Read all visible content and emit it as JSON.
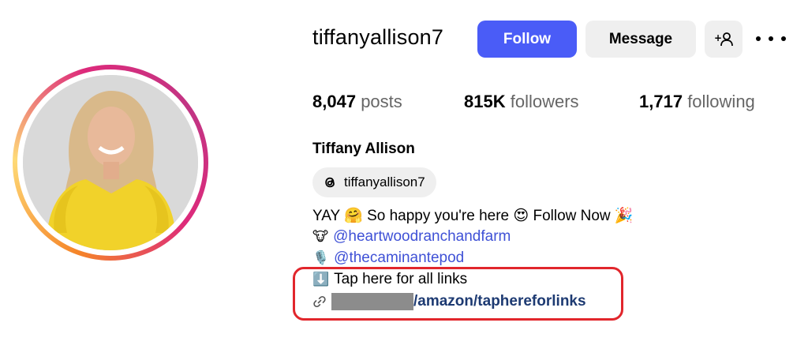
{
  "profile": {
    "username": "tiffanyallison7",
    "full_name": "Tiffany Allison",
    "threads_handle": "tiffanyallison7"
  },
  "actions": {
    "follow_label": "Follow",
    "message_label": "Message",
    "add_user_symbol": "+",
    "follow_color": "#4a5cf7"
  },
  "stats": {
    "posts_count": "8,047",
    "posts_label": "posts",
    "followers_count": "815K",
    "followers_label": "followers",
    "following_count": "1,717",
    "following_label": "following"
  },
  "bio": {
    "line1_text": "YAY 🤗 So happy you're here 😍 Follow Now 🎉",
    "line2_emoji": "🐮",
    "line2_mention": "@heartwoodranchandfarm",
    "line3_emoji": "🎙️",
    "line3_mention": "@thecaminantepod",
    "line4_emoji": "⬇️",
    "line4_text": "Tap here for all links",
    "line5_link": "/amazon/taphereforlinks"
  },
  "icons": {
    "link_icon": "link-icon",
    "threads_icon": "threads-icon",
    "more_icon": "more-options-icon",
    "add_person_icon": "add-person-icon"
  },
  "annotation": {
    "highlight_color": "#e1262c"
  }
}
